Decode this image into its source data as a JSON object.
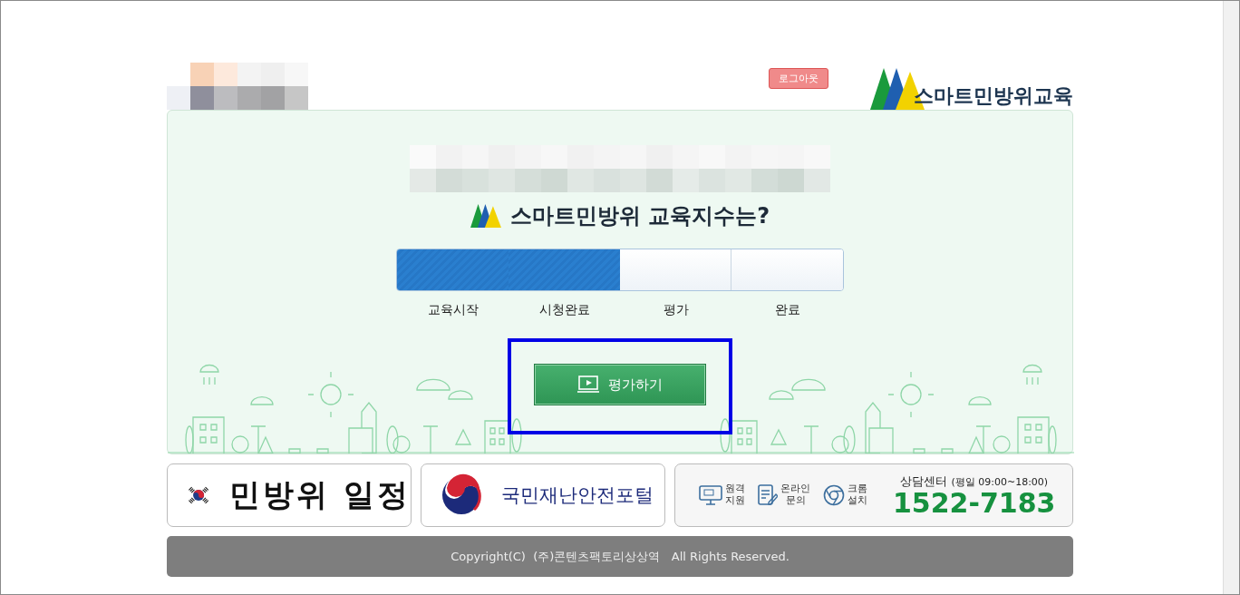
{
  "header": {
    "logout_button": "로그아웃",
    "logo_text": "스마트민방위교육"
  },
  "main": {
    "title": "스마트민방위 교육지수는?",
    "steps": [
      {
        "label": "교육시작",
        "completed": true
      },
      {
        "label": "시청완료",
        "completed": true
      },
      {
        "label": "평가",
        "completed": false
      },
      {
        "label": "완료",
        "completed": false
      }
    ],
    "action_button": {
      "label": "평가하기",
      "highlighted": true
    }
  },
  "banners": [
    {
      "kind": "schedule",
      "label": "민방위 일정"
    },
    {
      "kind": "portal",
      "label": "국민재난안전포털"
    }
  ],
  "support": {
    "links": [
      {
        "kind": "remote",
        "label": "원격\n지원"
      },
      {
        "kind": "inquiry",
        "label": "온라인\n문의"
      },
      {
        "kind": "chrome",
        "label": "크롬\n설치"
      }
    ],
    "center_label": "상담센터",
    "hours": "(평일 09:00~18:00)",
    "phone": "1522-7183"
  },
  "footer": "Copyright(C)  (주)콘텐츠팩토리상상역   All Rights Reserved."
}
